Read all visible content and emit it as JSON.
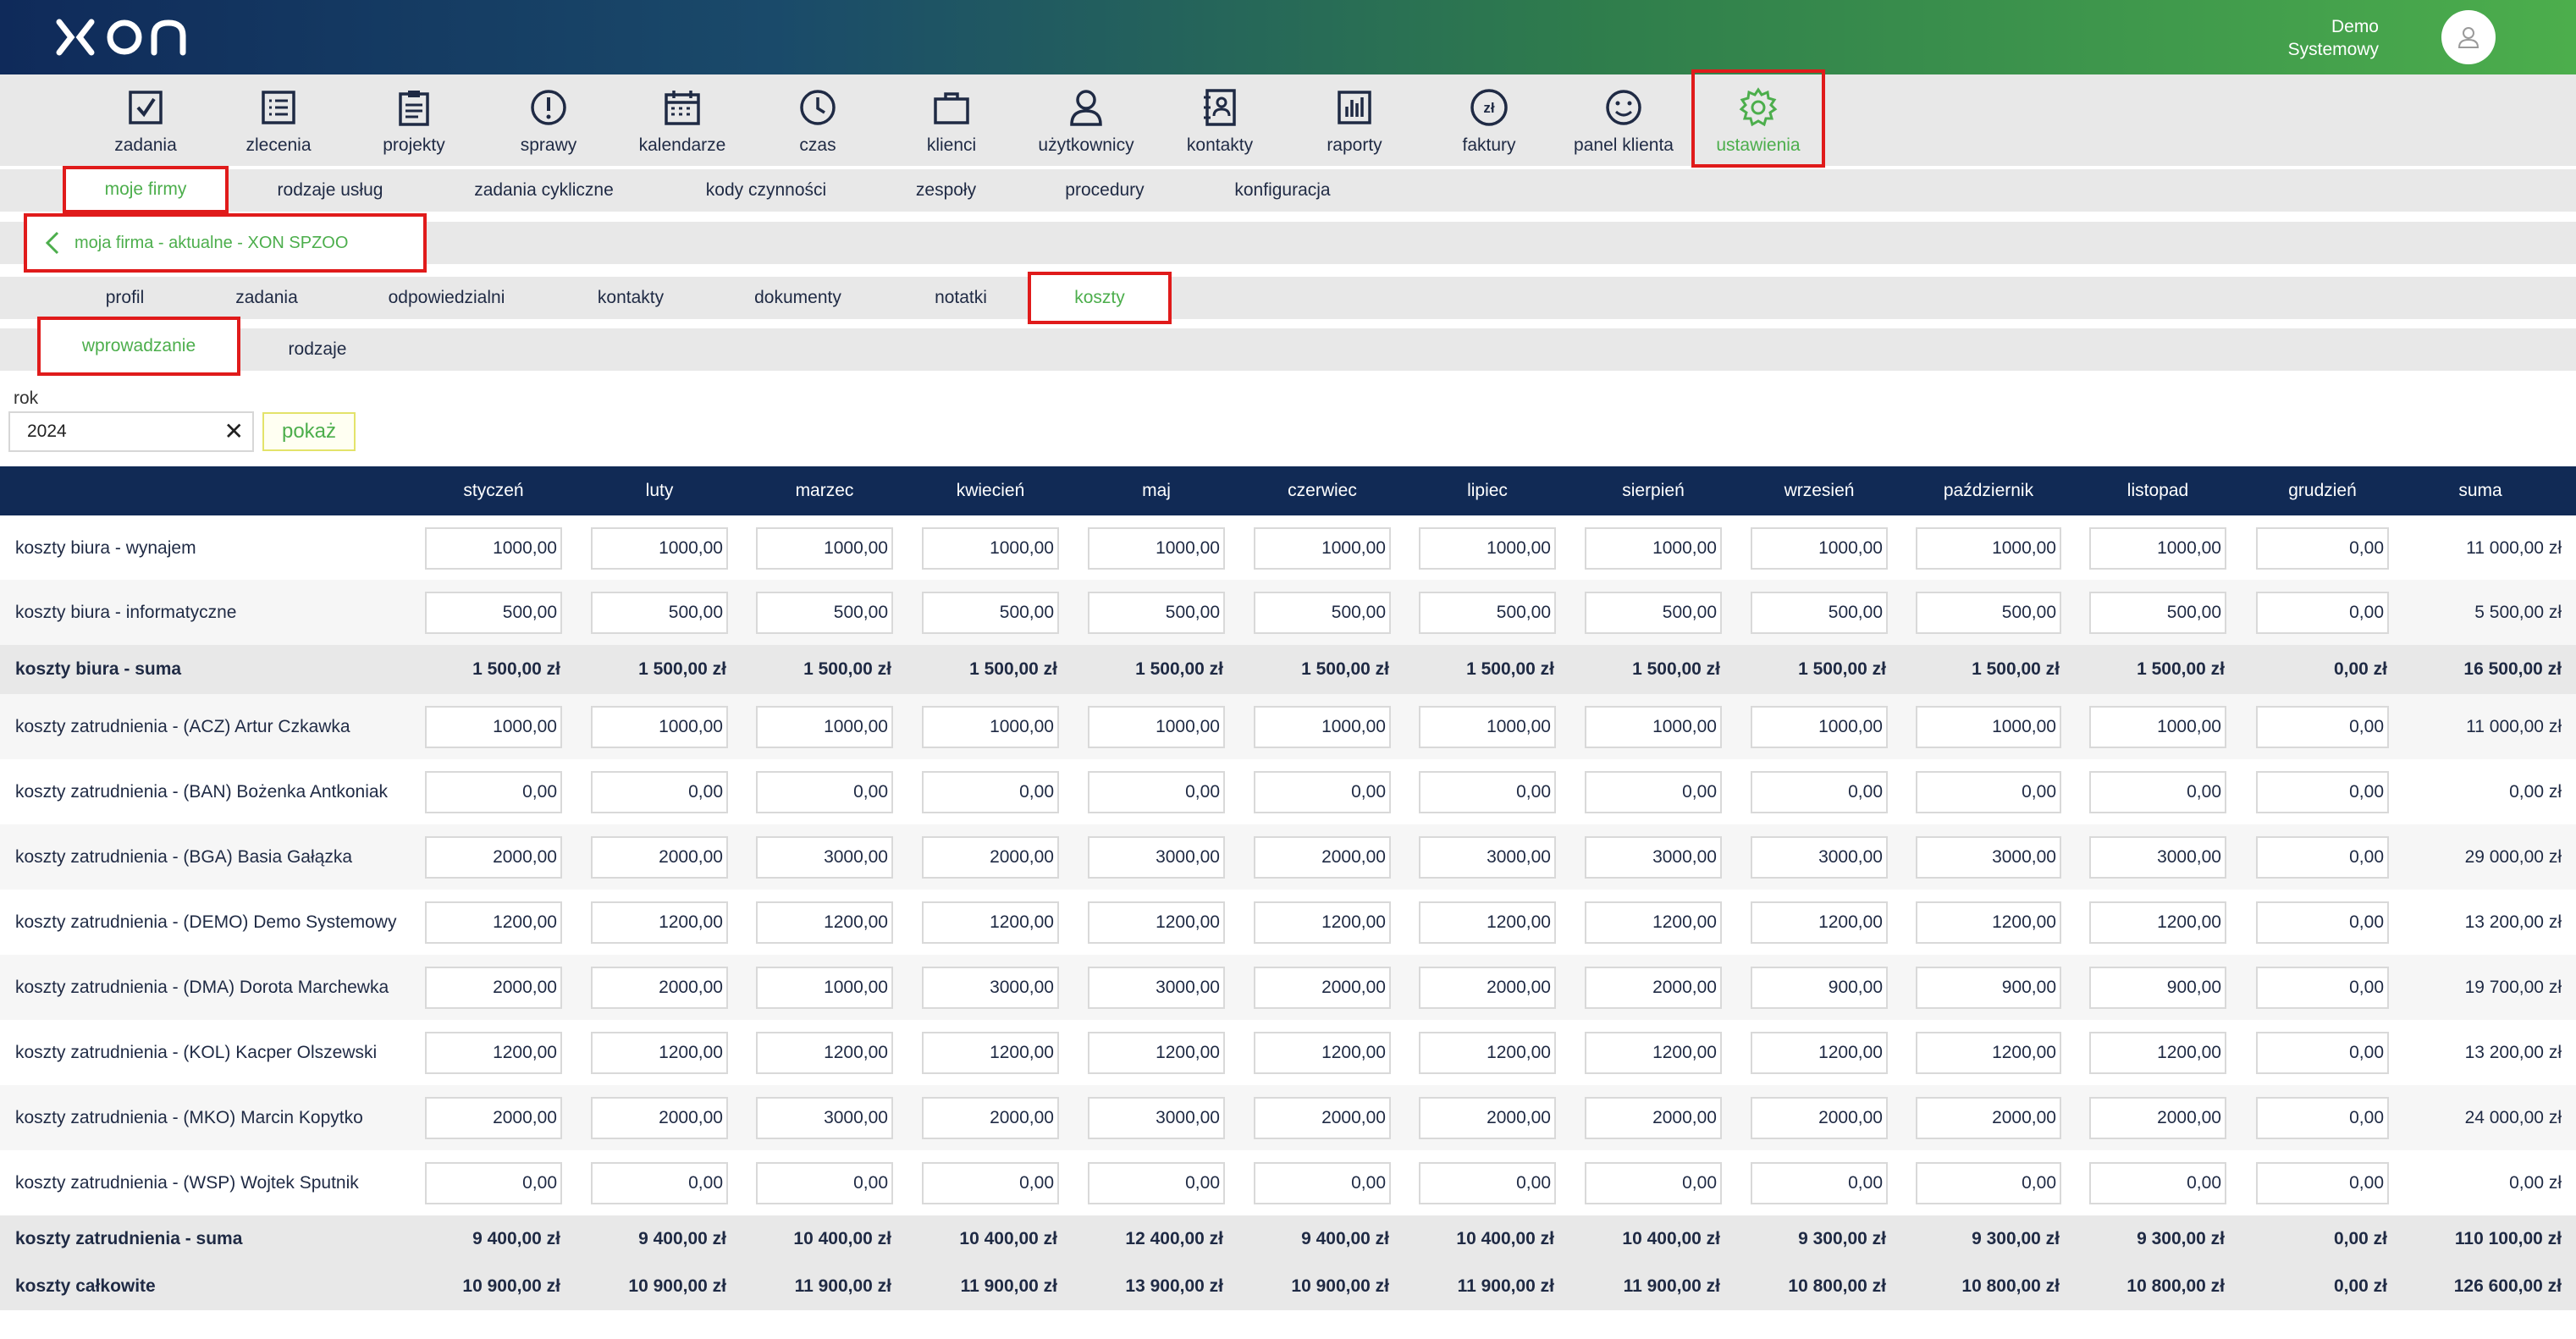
{
  "header": {
    "user_line1": "Demo",
    "user_line2": "Systemowy",
    "gradient_colors": [
      "#0f2a5a",
      "#4cae4c"
    ]
  },
  "main_nav": [
    {
      "label": "zadania",
      "icon": "checkbox-icon"
    },
    {
      "label": "zlecenia",
      "icon": "list-icon"
    },
    {
      "label": "projekty",
      "icon": "clipboard-icon"
    },
    {
      "label": "sprawy",
      "icon": "exclamation-icon"
    },
    {
      "label": "kalendarze",
      "icon": "calendar-icon"
    },
    {
      "label": "czas",
      "icon": "clock-icon"
    },
    {
      "label": "klienci",
      "icon": "briefcase-icon"
    },
    {
      "label": "użytkownicy",
      "icon": "user-icon"
    },
    {
      "label": "kontakty",
      "icon": "address-book-icon"
    },
    {
      "label": "raporty",
      "icon": "bar-chart-icon"
    },
    {
      "label": "faktury",
      "icon": "zloty-icon"
    },
    {
      "label": "panel klienta",
      "icon": "smiley-icon"
    },
    {
      "label": "ustawienia",
      "icon": "gear-icon",
      "active": true
    }
  ],
  "settings_tabs": [
    {
      "label": "moje firmy",
      "active": true
    },
    {
      "label": "rodzaje usług"
    },
    {
      "label": "zadania cykliczne"
    },
    {
      "label": "kody czynności"
    },
    {
      "label": "zespoły"
    },
    {
      "label": "procedury"
    },
    {
      "label": "konfiguracja"
    }
  ],
  "company_back": "moja firma - aktualne - XON SPZOO",
  "company_tabs": [
    {
      "label": "profil"
    },
    {
      "label": "zadania"
    },
    {
      "label": "odpowiedzialni"
    },
    {
      "label": "kontakty"
    },
    {
      "label": "dokumenty"
    },
    {
      "label": "notatki"
    },
    {
      "label": "koszty",
      "active": true
    }
  ],
  "cost_tabs": [
    {
      "label": "wprowadzanie",
      "active": true
    },
    {
      "label": "rodzaje"
    }
  ],
  "filter": {
    "year_label": "rok",
    "year_value": "2024",
    "clear_symbol": "✕",
    "show_label": "pokaż"
  },
  "table": {
    "months": [
      "styczeń",
      "luty",
      "marzec",
      "kwiecień",
      "maj",
      "czerwiec",
      "lipiec",
      "sierpień",
      "wrzesień",
      "październik",
      "listopad",
      "grudzień"
    ],
    "sum_header": "suma",
    "rows": [
      {
        "type": "input",
        "label": "koszty biura - wynajem",
        "values": [
          "1000,00",
          "1000,00",
          "1000,00",
          "1000,00",
          "1000,00",
          "1000,00",
          "1000,00",
          "1000,00",
          "1000,00",
          "1000,00",
          "1000,00",
          "0,00"
        ],
        "total": "11 000,00 zł"
      },
      {
        "type": "input",
        "label": "koszty biura - informatyczne",
        "values": [
          "500,00",
          "500,00",
          "500,00",
          "500,00",
          "500,00",
          "500,00",
          "500,00",
          "500,00",
          "500,00",
          "500,00",
          "500,00",
          "0,00"
        ],
        "total": "5 500,00 zł"
      },
      {
        "type": "sum",
        "label": "koszty biura - suma",
        "values": [
          "1 500,00 zł",
          "1 500,00 zł",
          "1 500,00 zł",
          "1 500,00 zł",
          "1 500,00 zł",
          "1 500,00 zł",
          "1 500,00 zł",
          "1 500,00 zł",
          "1 500,00 zł",
          "1 500,00 zł",
          "1 500,00 zł",
          "0,00 zł"
        ],
        "total": "16 500,00 zł"
      },
      {
        "type": "input",
        "label": "koszty zatrudnienia - (ACZ) Artur Czkawka",
        "values": [
          "1000,00",
          "1000,00",
          "1000,00",
          "1000,00",
          "1000,00",
          "1000,00",
          "1000,00",
          "1000,00",
          "1000,00",
          "1000,00",
          "1000,00",
          "0,00"
        ],
        "total": "11 000,00 zł"
      },
      {
        "type": "input",
        "label": "koszty zatrudnienia - (BAN) Bożenka Antkoniak",
        "values": [
          "0,00",
          "0,00",
          "0,00",
          "0,00",
          "0,00",
          "0,00",
          "0,00",
          "0,00",
          "0,00",
          "0,00",
          "0,00",
          "0,00"
        ],
        "total": "0,00 zł"
      },
      {
        "type": "input",
        "label": "koszty zatrudnienia - (BGA) Basia Gałązka",
        "values": [
          "2000,00",
          "2000,00",
          "3000,00",
          "2000,00",
          "3000,00",
          "2000,00",
          "3000,00",
          "3000,00",
          "3000,00",
          "3000,00",
          "3000,00",
          "0,00"
        ],
        "total": "29 000,00 zł"
      },
      {
        "type": "input",
        "label": "koszty zatrudnienia - (DEMO) Demo Systemowy",
        "values": [
          "1200,00",
          "1200,00",
          "1200,00",
          "1200,00",
          "1200,00",
          "1200,00",
          "1200,00",
          "1200,00",
          "1200,00",
          "1200,00",
          "1200,00",
          "0,00"
        ],
        "total": "13 200,00 zł"
      },
      {
        "type": "input",
        "label": "koszty zatrudnienia - (DMA) Dorota Marchewka",
        "values": [
          "2000,00",
          "2000,00",
          "1000,00",
          "3000,00",
          "3000,00",
          "2000,00",
          "2000,00",
          "2000,00",
          "900,00",
          "900,00",
          "900,00",
          "0,00"
        ],
        "total": "19 700,00 zł"
      },
      {
        "type": "input",
        "label": "koszty zatrudnienia - (KOL) Kacper Olszewski",
        "values": [
          "1200,00",
          "1200,00",
          "1200,00",
          "1200,00",
          "1200,00",
          "1200,00",
          "1200,00",
          "1200,00",
          "1200,00",
          "1200,00",
          "1200,00",
          "0,00"
        ],
        "total": "13 200,00 zł"
      },
      {
        "type": "input",
        "label": "koszty zatrudnienia - (MKO) Marcin Kopytko",
        "values": [
          "2000,00",
          "2000,00",
          "3000,00",
          "2000,00",
          "3000,00",
          "2000,00",
          "2000,00",
          "2000,00",
          "2000,00",
          "2000,00",
          "2000,00",
          "0,00"
        ],
        "total": "24 000,00 zł"
      },
      {
        "type": "input",
        "label": "koszty zatrudnienia - (WSP) Wojtek Sputnik",
        "values": [
          "0,00",
          "0,00",
          "0,00",
          "0,00",
          "0,00",
          "0,00",
          "0,00",
          "0,00",
          "0,00",
          "0,00",
          "0,00",
          "0,00"
        ],
        "total": "0,00 zł"
      },
      {
        "type": "sum",
        "label": "koszty zatrudnienia - suma",
        "values": [
          "9 400,00 zł",
          "9 400,00 zł",
          "10 400,00 zł",
          "10 400,00 zł",
          "12 400,00 zł",
          "9 400,00 zł",
          "10 400,00 zł",
          "10 400,00 zł",
          "9 300,00 zł",
          "9 300,00 zł",
          "9 300,00 zł",
          "0,00 zł"
        ],
        "total": "110 100,00 zł"
      },
      {
        "type": "total",
        "label": "koszty całkowite",
        "values": [
          "10 900,00 zł",
          "10 900,00 zł",
          "11 900,00 zł",
          "11 900,00 zł",
          "13 900,00 zł",
          "10 900,00 zł",
          "11 900,00 zł",
          "11 900,00 zł",
          "10 800,00 zł",
          "10 800,00 zł",
          "10 800,00 zł",
          "0,00 zł"
        ],
        "total": "126 600,00 zł"
      }
    ]
  }
}
